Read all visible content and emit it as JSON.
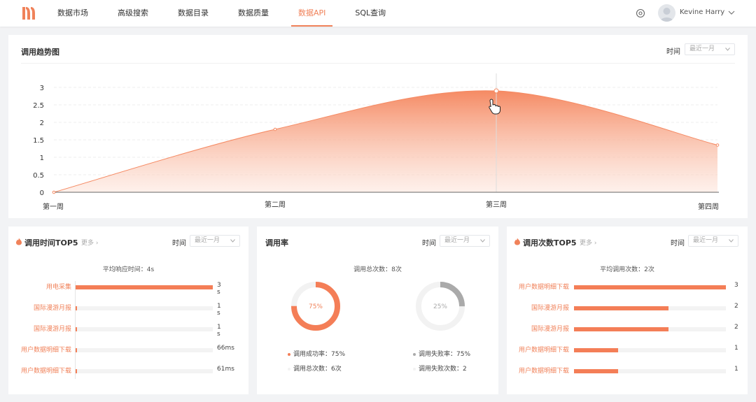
{
  "nav": {
    "items": [
      "数据市场",
      "高级搜索",
      "数据目录",
      "数据质量",
      "数据API",
      "SQL查询"
    ],
    "active_index": 4
  },
  "user": {
    "name": "Kevine Harry"
  },
  "colors": {
    "accent": "#f0825a",
    "bar": "#f47e57",
    "grey_ring": "#aaaaaa"
  },
  "trend": {
    "title": "调用趋势图",
    "time_label": "时间",
    "range_select": "最近一月",
    "chart_data": {
      "type": "area",
      "categories": [
        "第一周",
        "第二周",
        "第三周",
        "第四周"
      ],
      "values": [
        0,
        1.8,
        2.9,
        1.35
      ],
      "ylim": [
        0,
        3
      ],
      "yticks": [
        "0",
        "0.5",
        "1",
        "1.5",
        "2",
        "2.5",
        "3"
      ],
      "grid": true
    }
  },
  "top_time": {
    "title": "调用时间TOP5",
    "more": "更多",
    "time_label": "时间",
    "range_select": "最近一月",
    "subtitle": "平均响应时间：4s",
    "items": [
      {
        "label": "用电采集",
        "value_text": "3 s",
        "fraction": 1.0
      },
      {
        "label": "国际漫游月报",
        "value_text": "1 s",
        "fraction": 0.01
      },
      {
        "label": "国际漫游月报",
        "value_text": "1 s",
        "fraction": 0.01
      },
      {
        "label": "用户数据明细下载",
        "value_text": "66ms",
        "fraction": 0.005
      },
      {
        "label": "用户数据明细下载",
        "value_text": "61ms",
        "fraction": 0.005
      }
    ]
  },
  "rate": {
    "title": "调用率",
    "time_label": "时间",
    "range_select": "最近一月",
    "subtitle": "调用总次数：8次",
    "success": {
      "percent_text": "75%",
      "fraction": 0.75,
      "rate_text": "调用成功率：75%",
      "count_text": "调用总次数：6次"
    },
    "fail": {
      "percent_text": "25%",
      "fraction": 0.25,
      "rate_text": "调用失败率：75%",
      "count_text": "调用失败次数：2"
    }
  },
  "top_count": {
    "title": "调用次数TOP5",
    "more": "更多",
    "time_label": "时间",
    "range_select": "最近一月",
    "subtitle": "平均调用次数：2次",
    "items": [
      {
        "label": "用户数据明细下载",
        "value_text": "3",
        "fraction": 1.0
      },
      {
        "label": "国际漫游月报",
        "value_text": "2",
        "fraction": 0.62
      },
      {
        "label": "国际漫游月报",
        "value_text": "2",
        "fraction": 0.62
      },
      {
        "label": "用户数据明细下载",
        "value_text": "1",
        "fraction": 0.29
      },
      {
        "label": "用户数据明细下载",
        "value_text": "1",
        "fraction": 0.29
      }
    ]
  }
}
